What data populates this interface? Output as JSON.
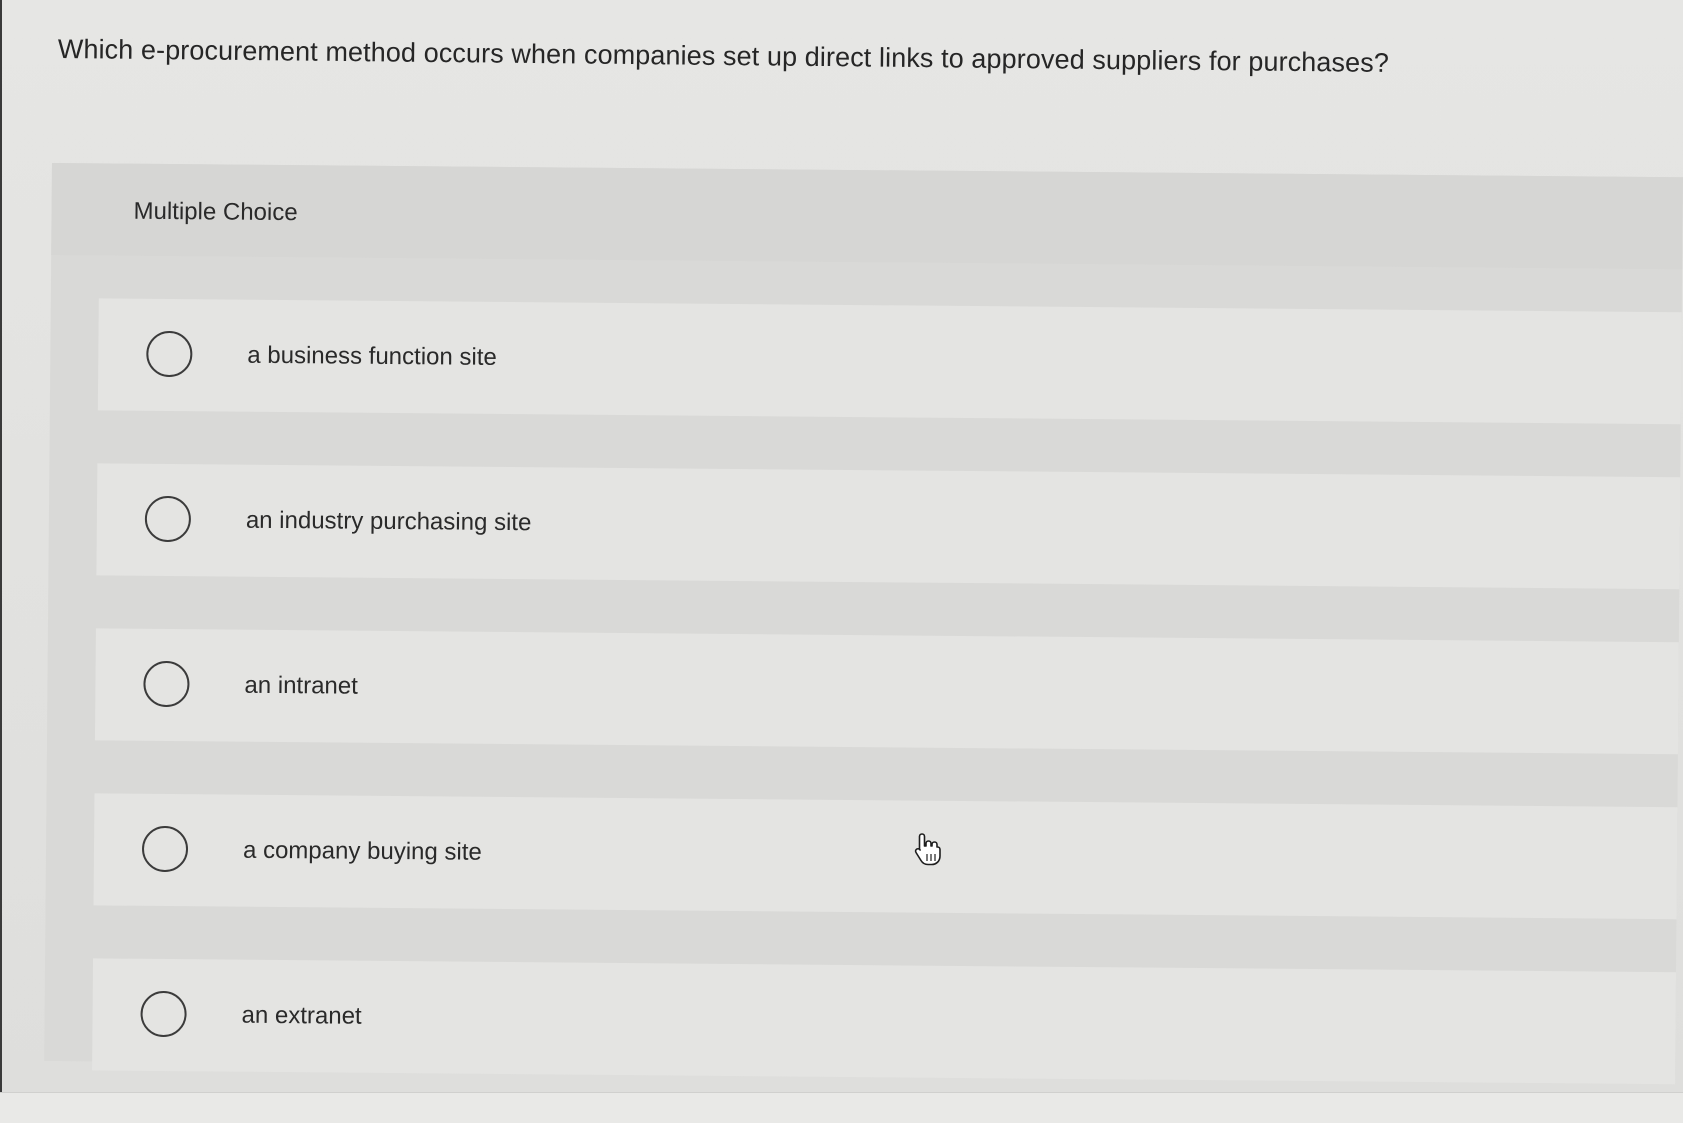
{
  "question": {
    "text": "Which e-procurement method occurs when companies set up direct links to approved suppliers for purchases?"
  },
  "multiple_choice": {
    "label": "Multiple Choice",
    "options": [
      {
        "label": "a business function site",
        "selected": false
      },
      {
        "label": "an industry purchasing site",
        "selected": false
      },
      {
        "label": "an intranet",
        "selected": false
      },
      {
        "label": "a company buying site",
        "selected": false
      },
      {
        "label": "an extranet",
        "selected": false
      }
    ]
  },
  "cursor": {
    "icon": "hand-pointer-icon"
  }
}
